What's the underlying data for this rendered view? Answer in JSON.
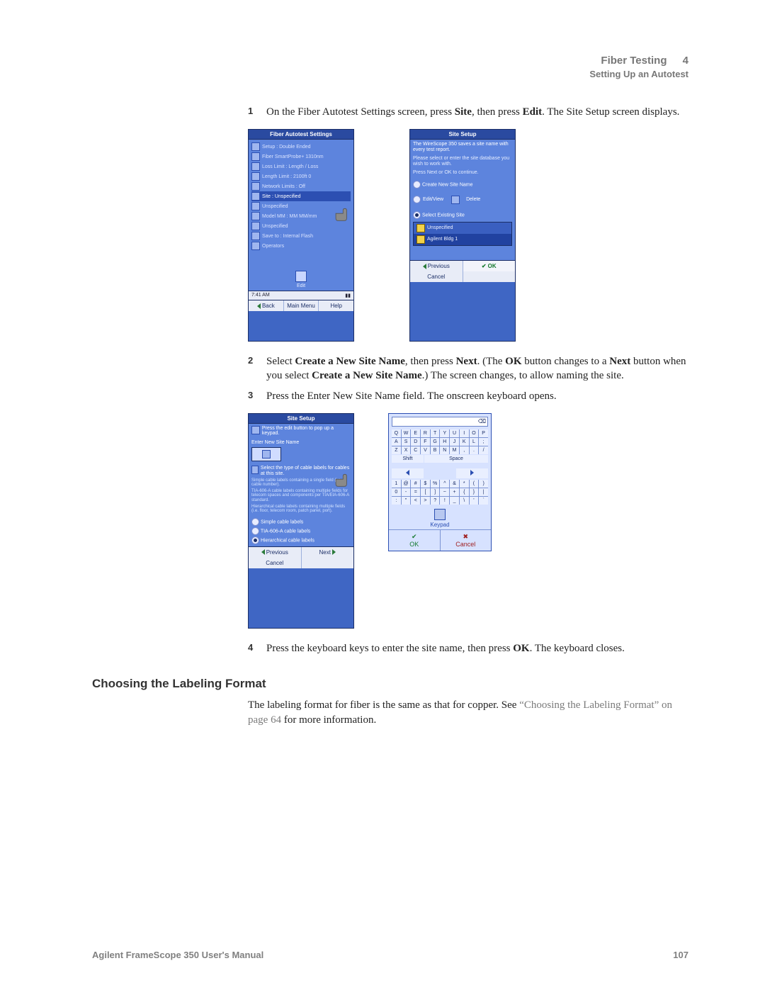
{
  "header": {
    "topic": "Fiber Testing",
    "chapter": "4",
    "subtitle": "Setting Up an Autotest"
  },
  "steps_a": [
    {
      "n": "1",
      "pre": "On the Fiber Autotest Settings screen, press ",
      "b1": "Site",
      "mid": ", then press ",
      "b2": "Edit",
      "post": ". The Site Setup screen displays."
    }
  ],
  "screen1": {
    "title": "Fiber Autotest Settings",
    "rows": [
      "Setup : Double Ended",
      "Fiber SmartProbe+ 1310nm",
      "Loss Limit : Length / Loss",
      "Length Limit : 2100ft  0",
      "Network Limits : Off",
      "Site : Unspecified",
      "Unspecified",
      "Model MM : MM MM/mm",
      "Unspecified",
      "Save to : Internal Flash",
      "Operators"
    ],
    "selected_index": 5,
    "edit_label": "Edit",
    "status_time": "7:41 AM",
    "buttons": [
      "Back",
      "Main Menu",
      "Help"
    ]
  },
  "screen2": {
    "title": "Site Setup",
    "intro1": "The WireScope 350 saves a site name with every test report.",
    "intro2": "Please select or enter the site database you wish to work with.",
    "intro3": "Press Next or OK to continue.",
    "opt_create": "Create New Site Name",
    "opt_edit": "Edit/View",
    "btn_delete": "Delete",
    "opt_select": "Select Existing Site",
    "list": [
      "Unspecified",
      "Agilent Bldg 1"
    ],
    "list_sel": 1,
    "prev": "Previous",
    "cancel": "Cancel",
    "ok": "OK"
  },
  "steps_b": [
    {
      "n": "2",
      "html_parts": [
        "Select ",
        "Create a New Site Name",
        ", then press ",
        "Next",
        ". (The ",
        "OK",
        " button changes to a ",
        "Next",
        " button when you select ",
        "Create a New Site Name",
        ".) The screen changes, to allow naming the site."
      ]
    },
    {
      "n": "3",
      "text": "Press the Enter New Site Name field. The onscreen keyboard opens."
    }
  ],
  "screen3": {
    "title": "Site Setup",
    "line1": "Press the edit button to pop up a keypad.",
    "field_label": "Enter New Site Name",
    "helper": "Select the type of cable labels for cables at this site.",
    "desc": [
      "Simple cable labels containing a single field (i.e. cable number).",
      "TIA-606-A cable labels containing multiple fields for telecom spaces and components per TIA/EIA-606-A standard.",
      "Hierarchical cable labels containing multiple fields (i.e. floor, telecom room, patch panel, port)."
    ],
    "opts": [
      "Simple cable labels",
      "TIA-606-A cable labels",
      "Hierarchical cable labels"
    ],
    "opt_sel": 2,
    "prev": "Previous",
    "next": "Next",
    "cancel": "Cancel"
  },
  "keyboard": {
    "row1": [
      "Q",
      "W",
      "E",
      "R",
      "T",
      "Y",
      "U",
      "I",
      "O",
      "P"
    ],
    "row2": [
      "A",
      "S",
      "D",
      "F",
      "G",
      "H",
      "J",
      "K",
      "L",
      ";"
    ],
    "row3": [
      "Z",
      "X",
      "C",
      "V",
      "B",
      "N",
      "M",
      ",",
      ".",
      "/"
    ],
    "shift": "Shift",
    "space": "Space",
    "numrow1": [
      "1",
      "@",
      "#",
      "$",
      "%",
      "^",
      "&",
      "*",
      "(",
      ")"
    ],
    "numrow2": [
      "0",
      "-",
      "=",
      "[",
      "]",
      "~",
      "+",
      "{",
      "}",
      "|"
    ],
    "numrow3": [
      ":",
      "\"",
      "<",
      ">",
      "?",
      "!",
      "_",
      "\\",
      "'",
      "`"
    ],
    "keypad_label": "Keypad",
    "ok": "OK",
    "cancel": "Cancel"
  },
  "steps_c": [
    {
      "n": "4",
      "pre": "Press the keyboard keys to enter the site name, then press ",
      "b1": "OK",
      "post": ". The keyboard closes."
    }
  ],
  "section_heading": "Choosing the Labeling Format",
  "section_para_pre": "The labeling format for fiber is the same as that for copper. See ",
  "section_para_xref": "“Choosing the Labeling Format” on page 64",
  "section_para_post": " for more information.",
  "footer": {
    "left": "Agilent FrameScope 350 User's Manual",
    "right": "107"
  }
}
